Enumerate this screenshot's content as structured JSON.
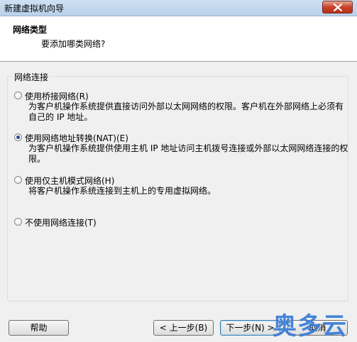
{
  "window": {
    "title": "新建虚拟机向导"
  },
  "header": {
    "title": "网络类型",
    "subtitle": "要添加哪类网络?"
  },
  "group": {
    "legend": "网络连接"
  },
  "options": [
    {
      "label": "使用桥接网络(R)",
      "description": "为客户机操作系统提供直接访问外部以太网网络的权限。客户机在外部网络上必须有自己的 IP 地址。",
      "selected": false
    },
    {
      "label": "使用网络地址转换(NAT)(E)",
      "description": "为客户机操作系统提供使用主机 IP 地址访问主机拨号连接或外部以太网网络连接的权限。",
      "selected": true
    },
    {
      "label": "使用仅主机模式网络(H)",
      "description": "将客户机操作系统连接到主机上的专用虚拟网络。",
      "selected": false
    },
    {
      "label": "不使用网络连接(T)",
      "description": "",
      "selected": false
    }
  ],
  "buttons": {
    "help": "帮助",
    "back": "< 上一步(B)",
    "next": "下一步(N) >",
    "cancel": "取消"
  },
  "watermark": "奥多云"
}
